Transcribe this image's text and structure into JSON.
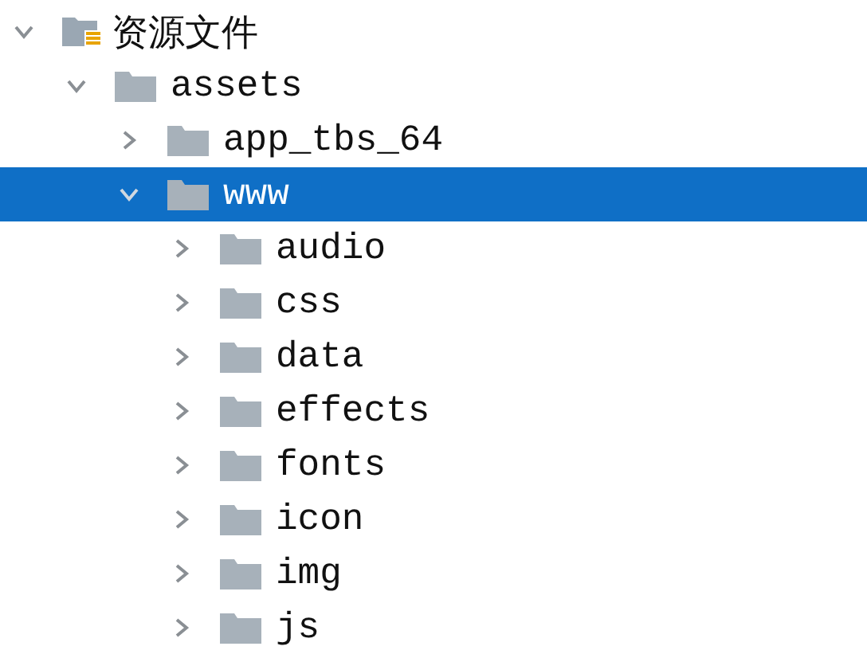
{
  "tree": [
    {
      "label": "资源文件",
      "kind": "resource",
      "expanded": true,
      "selected": false,
      "children": [
        {
          "label": "assets",
          "kind": "folder",
          "expanded": true,
          "selected": false,
          "children": [
            {
              "label": "app_tbs_64",
              "kind": "folder",
              "expanded": false,
              "selected": false
            },
            {
              "label": "www",
              "kind": "folder",
              "expanded": true,
              "selected": true,
              "children": [
                {
                  "label": "audio",
                  "kind": "folder",
                  "expanded": false,
                  "selected": false
                },
                {
                  "label": "css",
                  "kind": "folder",
                  "expanded": false,
                  "selected": false
                },
                {
                  "label": "data",
                  "kind": "folder",
                  "expanded": false,
                  "selected": false
                },
                {
                  "label": "effects",
                  "kind": "folder",
                  "expanded": false,
                  "selected": false
                },
                {
                  "label": "fonts",
                  "kind": "folder",
                  "expanded": false,
                  "selected": false
                },
                {
                  "label": "icon",
                  "kind": "folder",
                  "expanded": false,
                  "selected": false
                },
                {
                  "label": "img",
                  "kind": "folder",
                  "expanded": false,
                  "selected": false
                },
                {
                  "label": "js",
                  "kind": "folder",
                  "expanded": false,
                  "selected": false
                }
              ]
            }
          ]
        }
      ]
    }
  ]
}
